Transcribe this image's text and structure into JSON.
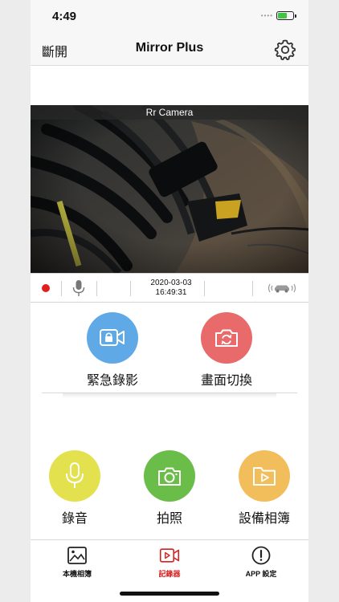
{
  "status_bar": {
    "time": "4:49",
    "signal": "••••",
    "battery_icon": "battery-charging-icon"
  },
  "navbar": {
    "left_label": "斷開",
    "title": "Mirror Plus",
    "settings_icon": "gear-icon"
  },
  "camera": {
    "label": "Rr Camera"
  },
  "controls": {
    "date": "2020-03-03",
    "time": "16:49:31",
    "record_icon": "record-dot-icon",
    "mic_icon": "mic-icon",
    "car_icon": "car-signal-icon"
  },
  "actions_top": [
    {
      "label": "緊急錄影",
      "icon": "lock-camera-icon",
      "color": "#5fa9e6"
    },
    {
      "label": "畫面切換",
      "icon": "camera-switch-icon",
      "color": "#e86a6a"
    }
  ],
  "actions_bottom": [
    {
      "label": "錄音",
      "icon": "mic-icon",
      "color": "#e4e14e"
    },
    {
      "label": "拍照",
      "icon": "camera-icon",
      "color": "#6bbd49"
    },
    {
      "label": "設備相簿",
      "icon": "video-folder-icon",
      "color": "#f2bd5b"
    }
  ],
  "tabbar": {
    "tabs": [
      {
        "label": "本機相簿",
        "icon": "image-icon",
        "active": false
      },
      {
        "label": "記錄器",
        "icon": "video-play-icon",
        "active": true
      },
      {
        "label": "APP 設定",
        "icon": "info-circle-icon",
        "active": false
      }
    ],
    "active_color": "#d71e1e"
  }
}
